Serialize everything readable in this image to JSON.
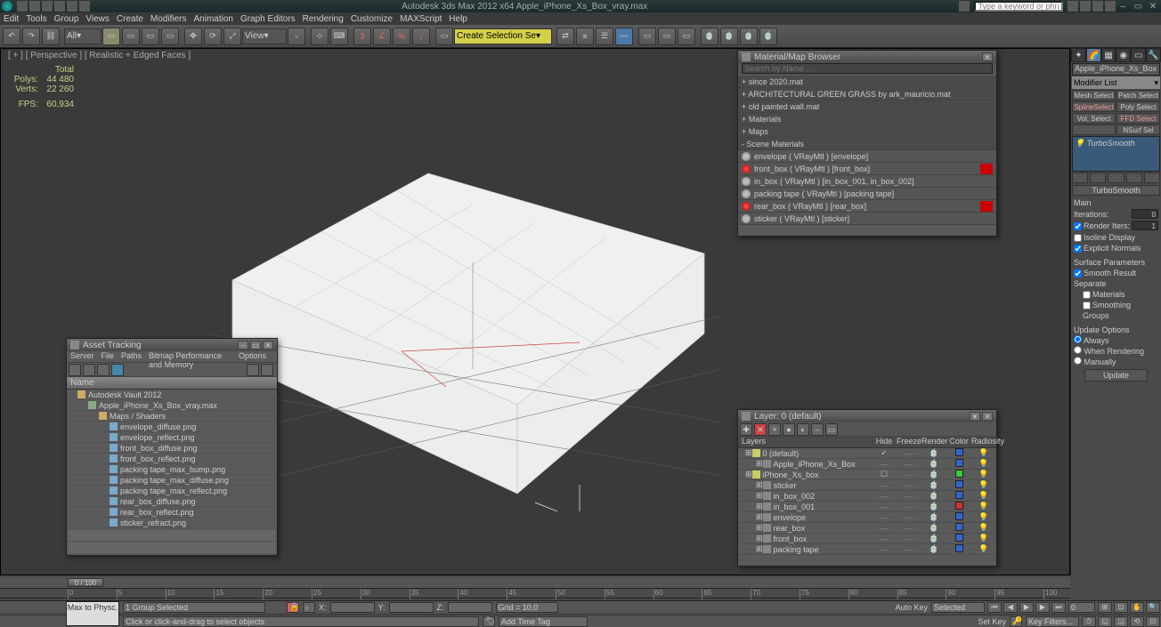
{
  "titlebar": {
    "text": "Autodesk 3ds Max 2012 x64      Apple_iPhone_Xs_Box_vray.max",
    "search_placeholder": "Type a keyword or phrase"
  },
  "menus": [
    "Edit",
    "Tools",
    "Group",
    "Views",
    "Create",
    "Modifiers",
    "Animation",
    "Graph Editors",
    "Rendering",
    "Customize",
    "MAXScript",
    "Help"
  ],
  "toolbar": {
    "dropdown_all": "All",
    "dropdown_view": "View",
    "selset": "Create Selection Se"
  },
  "viewport": {
    "label": "[ + ] [ Perspective ] [ Realistic + Edged Faces ]",
    "stats": {
      "total_label": "Total",
      "polys_label": "Polys:",
      "polys": "44 480",
      "verts_label": "Verts:",
      "verts": "22 260",
      "fps_label": "FPS:",
      "fps": "60,934"
    }
  },
  "cmdpanel": {
    "objname": "Apple_iPhone_Xs_Box",
    "modlist": "Modifier List",
    "mods": [
      "Mesh Select",
      "Patch Select",
      "SplineSelect",
      "Poly Select",
      "Vol. Select",
      "FFD Select",
      "",
      "NSurf Sel"
    ],
    "stack_item": "TurboSmooth",
    "roll_turbo": "TurboSmooth",
    "main": "Main",
    "iterations_label": "Iterations:",
    "iterations": "0",
    "render_iters_cb": "Render Iters:",
    "render_iters": "1",
    "isoline": "Isoline Display",
    "explicit": "Explicit Normals",
    "surface_params": "Surface Parameters",
    "smooth_result": "Smooth Result",
    "separate": "Separate",
    "materials": "Materials",
    "smoothing_groups": "Smoothing Groups",
    "update_options": "Update Options",
    "always": "Always",
    "when_rendering": "When Rendering",
    "manually": "Manually",
    "update_btn": "Update"
  },
  "material_browser": {
    "title": "Material/Map Browser",
    "search": "Search by Name ...",
    "libs": [
      "+ since 2020.mat",
      "+ ARCHITECTURAL GREEN GRASS by ark_mauricio.mat",
      "+ old painted wall.mat",
      "+ Materials",
      "+ Maps"
    ],
    "scene_label": "- Scene Materials",
    "scene": [
      {
        "name": "envelope ( VRayMtl ) [envelope]",
        "red": false
      },
      {
        "name": "front_box ( VRayMtl ) [front_box]",
        "red": true
      },
      {
        "name": "in_box ( VRayMtl ) [in_box_001, in_box_002]",
        "red": false
      },
      {
        "name": "packing tape ( VRayMtl ) [packing tape]",
        "red": false
      },
      {
        "name": "rear_box ( VRayMtl ) [rear_box]",
        "red": true
      },
      {
        "name": "sticker ( VRayMtl ) [sticker]",
        "red": false
      }
    ]
  },
  "asset_tracking": {
    "title": "Asset Tracking",
    "menus": [
      "Server",
      "File",
      "Paths",
      "Bitmap Performance and Memory",
      "Options"
    ],
    "col_name": "Name",
    "tree": [
      {
        "ind": 0,
        "icon": "y",
        "name": "Autodesk Vault 2012"
      },
      {
        "ind": 1,
        "icon": "g",
        "name": "Apple_iPhone_Xs_Box_vray.max"
      },
      {
        "ind": 2,
        "icon": "y",
        "name": "Maps / Shaders"
      },
      {
        "ind": 3,
        "icon": "img",
        "name": "envelope_diffuse.png"
      },
      {
        "ind": 3,
        "icon": "img",
        "name": "envelope_reflect.png"
      },
      {
        "ind": 3,
        "icon": "img",
        "name": "front_box_diffuse.png"
      },
      {
        "ind": 3,
        "icon": "img",
        "name": "front_box_reflect.png"
      },
      {
        "ind": 3,
        "icon": "img",
        "name": "packing tape_max_bump.png"
      },
      {
        "ind": 3,
        "icon": "img",
        "name": "packing tape_max_diffuse.png"
      },
      {
        "ind": 3,
        "icon": "img",
        "name": "packing tape_max_reflect.png"
      },
      {
        "ind": 3,
        "icon": "img",
        "name": "rear_box_diffuse.png"
      },
      {
        "ind": 3,
        "icon": "img",
        "name": "rear_box_reflect.png"
      },
      {
        "ind": 3,
        "icon": "img",
        "name": "sticker_refract.png"
      }
    ]
  },
  "layers": {
    "title": "Layer: 0 (default)",
    "cols": [
      "Layers",
      "Hide",
      "Freeze",
      "Render",
      "Color",
      "Radiosity"
    ],
    "rows": [
      {
        "ind": 0,
        "name": "0 (default)",
        "icon": "y",
        "hide": "✓",
        "color": "#36c"
      },
      {
        "ind": 1,
        "name": "Apple_iPhone_Xs_Box",
        "icon": "o",
        "color": "#36c"
      },
      {
        "ind": 0,
        "name": "iPhone_Xs_box",
        "icon": "y",
        "hide": "☐",
        "color": "#3c3"
      },
      {
        "ind": 1,
        "name": "sticker",
        "icon": "o",
        "color": "#36c"
      },
      {
        "ind": 1,
        "name": "in_box_002",
        "icon": "o",
        "color": "#36c"
      },
      {
        "ind": 1,
        "name": "in_box_001",
        "icon": "o",
        "color": "#c33"
      },
      {
        "ind": 1,
        "name": "envelope",
        "icon": "o",
        "color": "#36c"
      },
      {
        "ind": 1,
        "name": "rear_box",
        "icon": "o",
        "color": "#36c"
      },
      {
        "ind": 1,
        "name": "front_box",
        "icon": "o",
        "color": "#36c"
      },
      {
        "ind": 1,
        "name": "packing tape",
        "icon": "o",
        "color": "#36c"
      }
    ]
  },
  "time": {
    "slider": "0 / 100",
    "ticks": [
      0,
      5,
      10,
      15,
      20,
      25,
      30,
      35,
      40,
      45,
      50,
      55,
      60,
      65,
      70,
      75,
      80,
      85,
      90,
      95,
      100
    ]
  },
  "status": {
    "maxscript": "Max to Physc.",
    "sel": "1 Group Selected",
    "prompt": "Click or click-and-drag to select objects",
    "x": "X:",
    "y": "Y:",
    "z": "Z:",
    "grid": "Grid = 10,0",
    "autokey": "Auto Key",
    "selected": "Selected",
    "setkey": "Set Key",
    "keyfilters": "Key Filters...",
    "addtimetag": "Add Time Tag"
  }
}
